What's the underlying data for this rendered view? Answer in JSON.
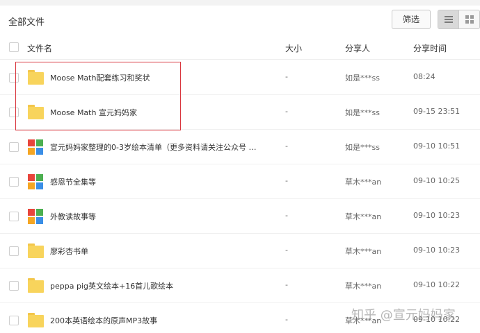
{
  "header": {
    "title": "全部文件",
    "filter_label": "筛选"
  },
  "columns": {
    "name": "文件名",
    "size": "大小",
    "sharer": "分享人",
    "time": "分享时间"
  },
  "rows": [
    {
      "icon": "folder-icon",
      "name": "Moose Math配套练习和奖状",
      "size": "-",
      "sharer": "如是***ss",
      "time": "08:24"
    },
    {
      "icon": "folder-icon",
      "name": "Moose Math 宣元妈妈家",
      "size": "-",
      "sharer": "如是***ss",
      "time": "09-15 23:51"
    },
    {
      "icon": "multi-file-icon",
      "name": "宣元妈妈家整理的0-3岁绘本清单（更多资料请关注公众号 …",
      "size": "-",
      "sharer": "如是***ss",
      "time": "09-10 10:51"
    },
    {
      "icon": "multi-file-icon",
      "name": "感恩节全集等",
      "size": "-",
      "sharer": "草木***an",
      "time": "09-10 10:25"
    },
    {
      "icon": "multi-file-icon",
      "name": "外教读故事等",
      "size": "-",
      "sharer": "草木***an",
      "time": "09-10 10:23"
    },
    {
      "icon": "folder-icon",
      "name": "廖彩杏书单",
      "size": "-",
      "sharer": "草木***an",
      "time": "09-10 10:23"
    },
    {
      "icon": "folder-icon",
      "name": "peppa pig英文绘本+16首儿歌绘本",
      "size": "-",
      "sharer": "草木***an",
      "time": "09-10 10:22"
    },
    {
      "icon": "folder-icon",
      "name": "200本英语绘本的原声MP3故事",
      "size": "-",
      "sharer": "草木***an",
      "time": "09-10 10:22"
    }
  ],
  "watermark": "知乎 @宣元妈妈家",
  "colors": {
    "folder": "#f8d45c",
    "highlight": "#d9363e",
    "app_red": "#e8453c",
    "app_green": "#4caf50",
    "app_orange": "#f5a623",
    "app_blue": "#3a8ee6"
  }
}
